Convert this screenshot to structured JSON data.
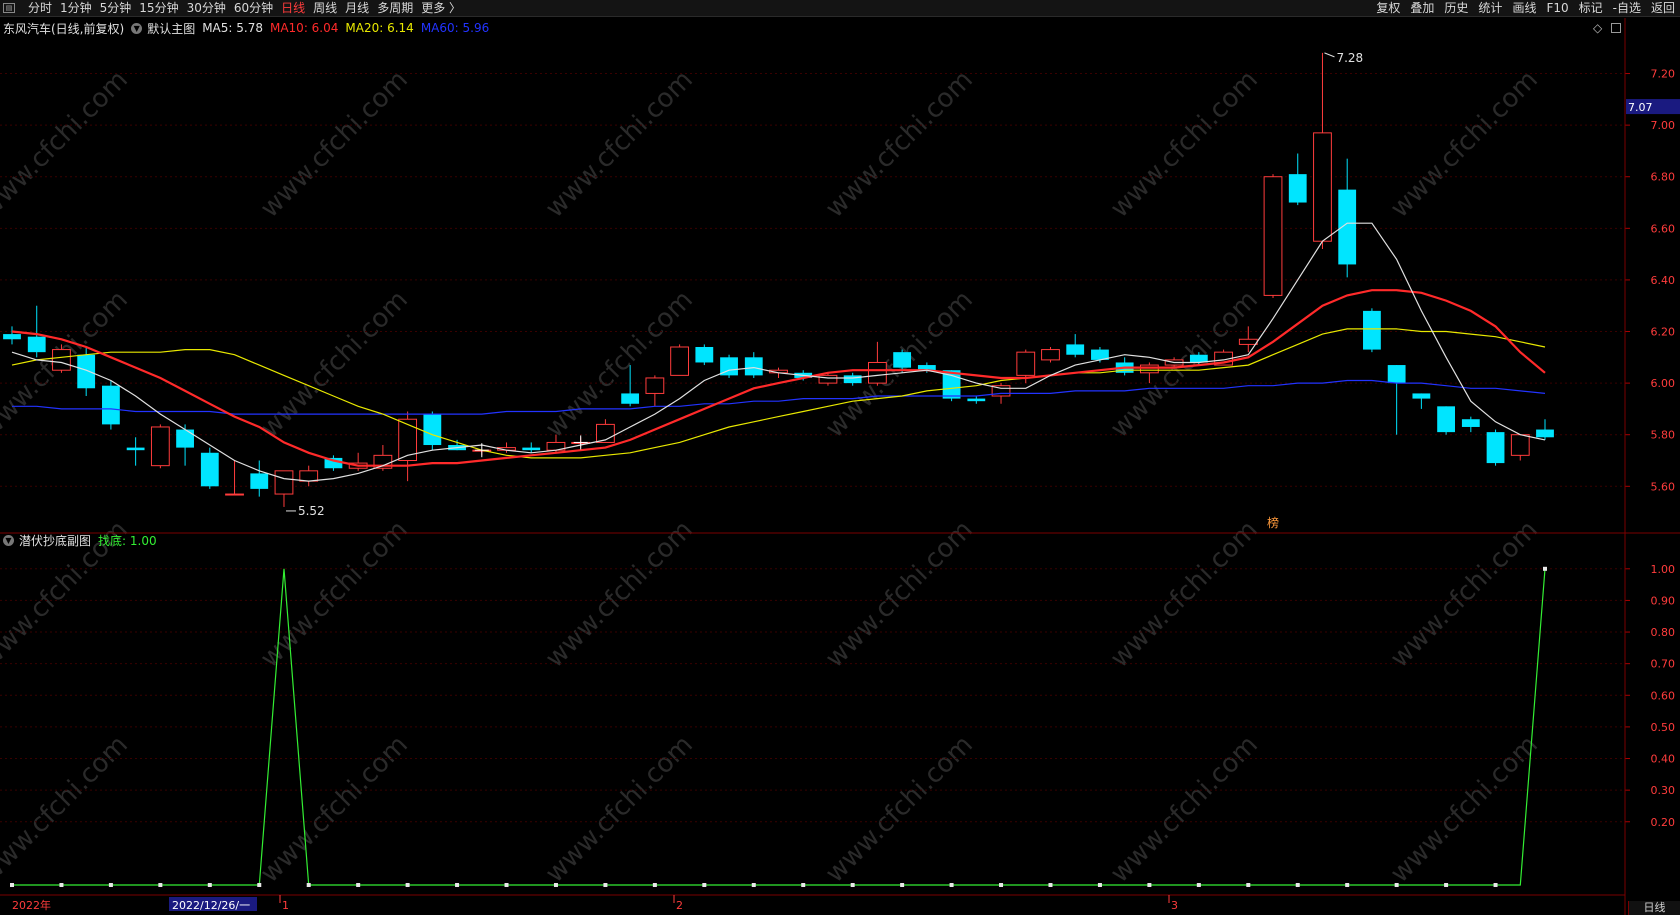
{
  "toolbar": {
    "menu_glyph": "▤",
    "periods": [
      "分时",
      "1分钟",
      "5分钟",
      "15分钟",
      "30分钟",
      "60分钟",
      "日线",
      "周线",
      "月线",
      "多周期",
      "更多 〉"
    ],
    "active_period": "日线",
    "right_tools": [
      "复权",
      "叠加",
      "历史",
      "统计",
      "画线",
      "F10",
      "标记",
      "-自选",
      "返回"
    ]
  },
  "main_panel": {
    "stock_title": "东风汽车(日线,前复权)",
    "indicator_name": "默认主图",
    "ma": [
      {
        "label": "MA5: 5.78",
        "color": "#e0e0e0"
      },
      {
        "label": "MA10: 6.04",
        "color": "#ff2a2a"
      },
      {
        "label": "MA20: 6.14",
        "color": "#e8e800"
      },
      {
        "label": "MA60: 5.96",
        "color": "#2233ff"
      }
    ],
    "price_axis_labels": [
      "7.20",
      "7.00",
      "6.80",
      "6.60",
      "6.40",
      "6.20",
      "6.00",
      "5.80",
      "5.60"
    ],
    "current_price_tag": "7.07",
    "high_marker": "7.28",
    "low_marker": "5.52",
    "special_badge": "榜",
    "diamond_icon": "◇"
  },
  "sub_panel": {
    "indicator_name": "潜伏抄底副图",
    "value_label": "找底: 1.00",
    "axis_labels": [
      "1.00",
      "0.90",
      "0.80",
      "0.70",
      "0.60",
      "0.50",
      "0.40",
      "0.30",
      "0.20"
    ]
  },
  "date_axis": {
    "year_label": "2022年",
    "cursor_date": "2022/12/26/一",
    "month_labels": [
      "1",
      "2",
      "3"
    ]
  },
  "bottom_right_label": "日线",
  "watermark": "www.cfchi.com",
  "colors": {
    "up_candle": "#ff3c3c",
    "down_candle": "#00e5ff",
    "ma5": "#e0e0e0",
    "ma10": "#ff2a2a",
    "ma20": "#e8e800",
    "ma60": "#2233ff",
    "signal_line": "#33ee33",
    "panel_border": "#7a0000"
  },
  "chart_data": {
    "type": "candlestick",
    "y_range": [
      5.45,
      7.33
    ],
    "candles": [
      {
        "o": 6.19,
        "c": 6.17,
        "h": 6.22,
        "l": 6.15
      },
      {
        "o": 6.18,
        "c": 6.12,
        "h": 6.3,
        "l": 6.1
      },
      {
        "o": 6.05,
        "c": 6.13,
        "h": 6.15,
        "l": 6.04
      },
      {
        "o": 6.11,
        "c": 5.98,
        "h": 6.14,
        "l": 5.95
      },
      {
        "o": 5.99,
        "c": 5.84,
        "h": 6.01,
        "l": 5.82
      },
      {
        "o": 5.75,
        "c": 5.74,
        "h": 5.79,
        "l": 5.68
      },
      {
        "o": 5.68,
        "c": 5.83,
        "h": 5.84,
        "l": 5.67
      },
      {
        "o": 5.82,
        "c": 5.75,
        "h": 5.84,
        "l": 5.68
      },
      {
        "o": 5.73,
        "c": 5.6,
        "h": 5.75,
        "l": 5.59
      },
      {
        "o": 5.57,
        "c": 5.57,
        "h": 5.7,
        "l": 5.57
      },
      {
        "o": 5.65,
        "c": 5.59,
        "h": 5.7,
        "l": 5.56
      },
      {
        "o": 5.57,
        "c": 5.66,
        "h": 5.66,
        "l": 5.52
      },
      {
        "o": 5.62,
        "c": 5.66,
        "h": 5.68,
        "l": 5.6
      },
      {
        "o": 5.71,
        "c": 5.67,
        "h": 5.72,
        "l": 5.66
      },
      {
        "o": 5.67,
        "c": 5.69,
        "h": 5.73,
        "l": 5.66
      },
      {
        "o": 5.67,
        "c": 5.72,
        "h": 5.76,
        "l": 5.66
      },
      {
        "o": 5.7,
        "c": 5.86,
        "h": 5.89,
        "l": 5.62
      },
      {
        "o": 5.88,
        "c": 5.76,
        "h": 5.89,
        "l": 5.74
      },
      {
        "o": 5.76,
        "c": 5.74,
        "h": 5.78,
        "l": 5.74
      },
      {
        "o": 5.74,
        "c": 5.74,
        "h": 5.74,
        "l": 5.72
      },
      {
        "o": 5.74,
        "c": 5.75,
        "h": 5.77,
        "l": 5.73
      },
      {
        "o": 5.75,
        "c": 5.74,
        "h": 5.77,
        "l": 5.73
      },
      {
        "o": 5.74,
        "c": 5.77,
        "h": 5.8,
        "l": 5.73
      },
      {
        "o": 5.77,
        "c": 5.77,
        "h": 5.79,
        "l": 5.75
      },
      {
        "o": 5.77,
        "c": 5.84,
        "h": 5.86,
        "l": 5.77
      },
      {
        "o": 5.96,
        "c": 5.92,
        "h": 6.07,
        "l": 5.91
      },
      {
        "o": 5.96,
        "c": 6.02,
        "h": 6.03,
        "l": 5.91
      },
      {
        "o": 6.03,
        "c": 6.14,
        "h": 6.15,
        "l": 6.03
      },
      {
        "o": 6.14,
        "c": 6.08,
        "h": 6.15,
        "l": 6.07
      },
      {
        "o": 6.1,
        "c": 6.03,
        "h": 6.11,
        "l": 6.02
      },
      {
        "o": 6.1,
        "c": 6.03,
        "h": 6.12,
        "l": 6.02
      },
      {
        "o": 6.04,
        "c": 6.05,
        "h": 6.06,
        "l": 6.02
      },
      {
        "o": 6.04,
        "c": 6.02,
        "h": 6.05,
        "l": 6.01
      },
      {
        "o": 6.0,
        "c": 6.03,
        "h": 6.04,
        "l": 5.99
      },
      {
        "o": 6.03,
        "c": 6.0,
        "h": 6.04,
        "l": 5.99
      },
      {
        "o": 6.0,
        "c": 6.08,
        "h": 6.16,
        "l": 5.99
      },
      {
        "o": 6.12,
        "c": 6.06,
        "h": 6.13,
        "l": 6.04
      },
      {
        "o": 6.07,
        "c": 6.05,
        "h": 6.08,
        "l": 6.04
      },
      {
        "o": 6.05,
        "c": 5.94,
        "h": 6.05,
        "l": 5.93
      },
      {
        "o": 5.94,
        "c": 5.93,
        "h": 5.95,
        "l": 5.92
      },
      {
        "o": 5.95,
        "c": 5.99,
        "h": 6.0,
        "l": 5.92
      },
      {
        "o": 6.03,
        "c": 6.12,
        "h": 6.13,
        "l": 6.0
      },
      {
        "o": 6.09,
        "c": 6.13,
        "h": 6.14,
        "l": 6.08
      },
      {
        "o": 6.15,
        "c": 6.11,
        "h": 6.19,
        "l": 6.1
      },
      {
        "o": 6.13,
        "c": 6.09,
        "h": 6.14,
        "l": 6.08
      },
      {
        "o": 6.08,
        "c": 6.04,
        "h": 6.1,
        "l": 6.03
      },
      {
        "o": 6.04,
        "c": 6.07,
        "h": 6.08,
        "l": 6.0
      },
      {
        "o": 6.07,
        "c": 6.09,
        "h": 6.1,
        "l": 6.06
      },
      {
        "o": 6.11,
        "c": 6.08,
        "h": 6.12,
        "l": 6.07
      },
      {
        "o": 6.07,
        "c": 6.12,
        "h": 6.13,
        "l": 6.07
      },
      {
        "o": 6.15,
        "c": 6.17,
        "h": 6.22,
        "l": 6.12
      },
      {
        "o": 6.34,
        "c": 6.8,
        "h": 6.81,
        "l": 6.33
      },
      {
        "o": 6.81,
        "c": 6.7,
        "h": 6.89,
        "l": 6.69
      },
      {
        "o": 6.55,
        "c": 6.97,
        "h": 7.28,
        "l": 6.52
      },
      {
        "o": 6.75,
        "c": 6.46,
        "h": 6.87,
        "l": 6.41
      },
      {
        "o": 6.28,
        "c": 6.13,
        "h": 6.29,
        "l": 6.12
      },
      {
        "o": 6.07,
        "c": 6.0,
        "h": 6.07,
        "l": 5.8
      },
      {
        "o": 5.96,
        "c": 5.94,
        "h": 5.96,
        "l": 5.9
      },
      {
        "o": 5.91,
        "c": 5.81,
        "h": 5.91,
        "l": 5.8
      },
      {
        "o": 5.86,
        "c": 5.83,
        "h": 5.87,
        "l": 5.81
      },
      {
        "o": 5.81,
        "c": 5.69,
        "h": 5.82,
        "l": 5.68
      },
      {
        "o": 5.72,
        "c": 5.8,
        "h": 5.8,
        "l": 5.7
      },
      {
        "o": 5.82,
        "c": 5.79,
        "h": 5.86,
        "l": 5.78
      }
    ],
    "ma5": [
      6.12,
      6.09,
      6.08,
      6.05,
      6.01,
      5.95,
      5.88,
      5.82,
      5.76,
      5.7,
      5.66,
      5.63,
      5.62,
      5.63,
      5.65,
      5.68,
      5.72,
      5.74,
      5.75,
      5.76,
      5.74,
      5.73,
      5.74,
      5.76,
      5.78,
      5.83,
      5.88,
      5.94,
      6.01,
      6.05,
      6.06,
      6.04,
      6.03,
      6.02,
      6.02,
      6.03,
      6.04,
      6.05,
      6.03,
      6.0,
      5.98,
      5.98,
      6.03,
      6.07,
      6.09,
      6.11,
      6.1,
      6.08,
      6.08,
      6.09,
      6.11,
      6.25,
      6.4,
      6.55,
      6.62,
      6.62,
      6.48,
      6.28,
      6.1,
      5.93,
      5.85,
      5.8,
      5.78
    ],
    "ma10": [
      6.2,
      6.19,
      6.17,
      6.14,
      6.1,
      6.06,
      6.02,
      5.97,
      5.92,
      5.87,
      5.83,
      5.77,
      5.73,
      5.7,
      5.68,
      5.68,
      5.68,
      5.69,
      5.69,
      5.7,
      5.71,
      5.72,
      5.73,
      5.74,
      5.75,
      5.78,
      5.82,
      5.86,
      5.9,
      5.94,
      5.98,
      6.0,
      6.02,
      6.04,
      6.05,
      6.05,
      6.05,
      6.05,
      6.04,
      6.03,
      6.02,
      6.02,
      6.03,
      6.04,
      6.05,
      6.06,
      6.06,
      6.06,
      6.07,
      6.08,
      6.1,
      6.16,
      6.23,
      6.3,
      6.34,
      6.36,
      6.36,
      6.35,
      6.32,
      6.28,
      6.22,
      6.12,
      6.04
    ],
    "ma20": [
      6.07,
      6.09,
      6.1,
      6.11,
      6.12,
      6.12,
      6.12,
      6.13,
      6.13,
      6.11,
      6.07,
      6.03,
      5.99,
      5.95,
      5.91,
      5.88,
      5.84,
      5.8,
      5.77,
      5.74,
      5.72,
      5.71,
      5.71,
      5.71,
      5.72,
      5.73,
      5.75,
      5.77,
      5.8,
      5.83,
      5.85,
      5.87,
      5.89,
      5.91,
      5.93,
      5.94,
      5.95,
      5.97,
      5.98,
      5.99,
      6.01,
      6.02,
      6.03,
      6.04,
      6.04,
      6.05,
      6.05,
      6.05,
      6.05,
      6.06,
      6.07,
      6.11,
      6.15,
      6.19,
      6.21,
      6.21,
      6.21,
      6.2,
      6.2,
      6.19,
      6.18,
      6.16,
      6.14
    ],
    "ma60": [
      5.91,
      5.91,
      5.9,
      5.9,
      5.9,
      5.89,
      5.89,
      5.89,
      5.89,
      5.88,
      5.88,
      5.88,
      5.88,
      5.88,
      5.88,
      5.88,
      5.88,
      5.88,
      5.88,
      5.88,
      5.89,
      5.89,
      5.89,
      5.9,
      5.9,
      5.9,
      5.91,
      5.91,
      5.92,
      5.92,
      5.93,
      5.93,
      5.94,
      5.94,
      5.94,
      5.95,
      5.95,
      5.95,
      5.95,
      5.95,
      5.96,
      5.96,
      5.96,
      5.97,
      5.97,
      5.97,
      5.98,
      5.98,
      5.98,
      5.98,
      5.99,
      5.99,
      6.0,
      6.0,
      6.01,
      6.01,
      6.0,
      6.0,
      5.99,
      5.98,
      5.98,
      5.97,
      5.96
    ],
    "signal_y_range": [
      0,
      1.05
    ],
    "signal": [
      0,
      0,
      0,
      0,
      0,
      0,
      0,
      0,
      0,
      0,
      0,
      1,
      0,
      0,
      0,
      0,
      0,
      0,
      0,
      0,
      0,
      0,
      0,
      0,
      0,
      0,
      0,
      0,
      0,
      0,
      0,
      0,
      0,
      0,
      0,
      0,
      0,
      0,
      0,
      0,
      0,
      0,
      0,
      0,
      0,
      0,
      0,
      0,
      0,
      0,
      0,
      0,
      0,
      0,
      0,
      0,
      0,
      0,
      0,
      0,
      0,
      0,
      1
    ],
    "signal_markers_every": 2
  }
}
